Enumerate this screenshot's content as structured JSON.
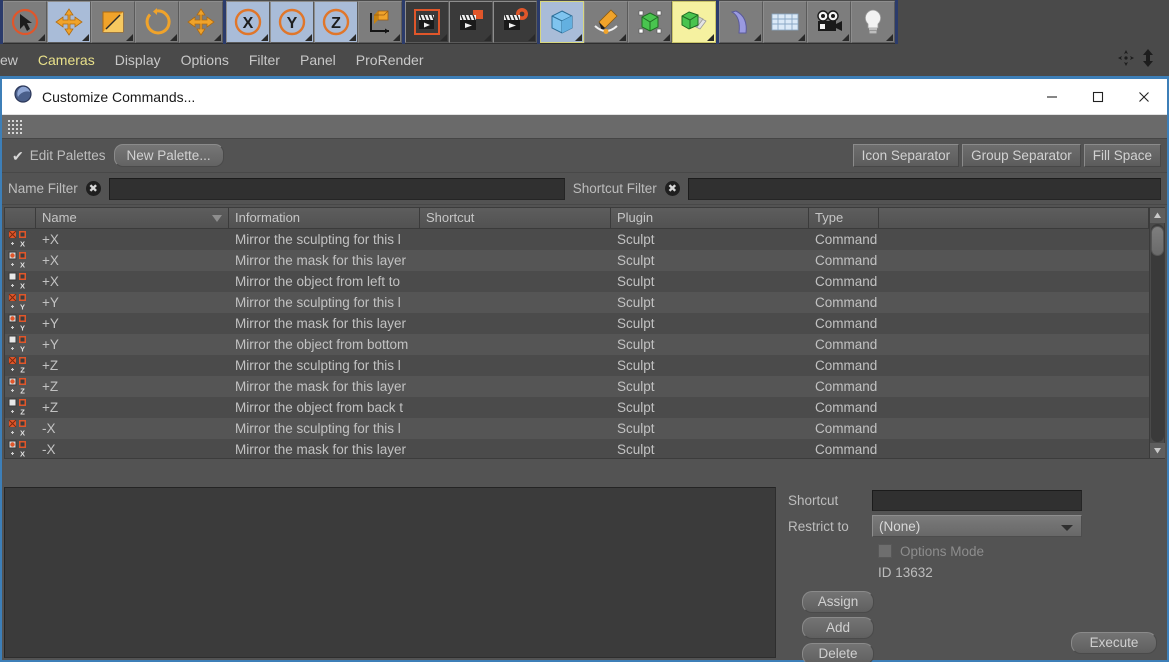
{
  "toolbar": {
    "items": [
      {
        "name": "live-selection-tool",
        "icon": "cursor-circle-icon",
        "state": "selected-red"
      },
      {
        "name": "move-tool",
        "icon": "move-arrows-icon",
        "state": "selected"
      },
      {
        "name": "scale-tool",
        "icon": "scale-square-icon",
        "state": "normal"
      },
      {
        "name": "rotate-tool",
        "icon": "rotate-circle-icon",
        "state": "normal"
      },
      {
        "name": "move-tool-2",
        "icon": "move-arrows-icon",
        "state": "normal"
      },
      {
        "name": "x-axis-lock",
        "icon": "axis-x-icon",
        "state": "selected"
      },
      {
        "name": "y-axis-lock",
        "icon": "axis-y-icon",
        "state": "selected"
      },
      {
        "name": "z-axis-lock",
        "icon": "axis-z-icon",
        "state": "selected"
      },
      {
        "name": "world-object-coordinates",
        "icon": "cube-axis-icon",
        "state": "normal"
      },
      {
        "name": "render-view",
        "icon": "clapper-render-icon",
        "state": "dark-red"
      },
      {
        "name": "render-region",
        "icon": "clapper-region-icon",
        "state": "dark"
      },
      {
        "name": "render-settings",
        "icon": "clapper-gear-icon",
        "state": "dark"
      },
      {
        "name": "add-cube-object",
        "icon": "cube-blue-icon",
        "state": "yellow-outline"
      },
      {
        "name": "add-spline",
        "icon": "pen-spline-icon",
        "state": "normal"
      },
      {
        "name": "generators",
        "icon": "green-cube-array-icon",
        "state": "normal"
      },
      {
        "name": "deformers",
        "icon": "green-cube-stack-icon",
        "state": "yellow-selected"
      },
      {
        "name": "bend-deformer",
        "icon": "bend-shape-icon",
        "state": "normal"
      },
      {
        "name": "floor-environment",
        "icon": "grid-floor-icon",
        "state": "normal"
      },
      {
        "name": "add-camera",
        "icon": "camera-icon",
        "state": "normal"
      },
      {
        "name": "add-light",
        "icon": "light-bulb-icon",
        "state": "normal"
      }
    ]
  },
  "menubar": {
    "items": [
      {
        "label": "ew",
        "active": false
      },
      {
        "label": "Cameras",
        "active": true
      },
      {
        "label": "Display",
        "active": false
      },
      {
        "label": "Options",
        "active": false
      },
      {
        "label": "Filter",
        "active": false
      },
      {
        "label": "Panel",
        "active": false
      },
      {
        "label": "ProRender",
        "active": false
      }
    ],
    "right_icons": [
      "move-cross-icon",
      "resize-vertical-icon"
    ]
  },
  "dialog": {
    "title": "Customize Commands...",
    "app_icon": "cinema4d-logo-icon",
    "window_controls": {
      "minimize": "—",
      "maximize": "□",
      "close": "✕"
    },
    "palettes_bar": {
      "edit_palettes_checked": true,
      "edit_palettes_label": "Edit Palettes",
      "new_palette_label": "New Palette...",
      "icon_separator_label": "Icon Separator",
      "group_separator_label": "Group Separator",
      "fill_space_label": "Fill Space"
    },
    "filters": {
      "name_filter_label": "Name Filter",
      "name_filter_value": "",
      "name_filter_placeholder": "",
      "shortcut_filter_label": "Shortcut Filter",
      "shortcut_filter_value": "",
      "shortcut_filter_placeholder": ""
    },
    "table": {
      "columns": [
        "",
        "Name",
        "Information",
        "Shortcut",
        "Plugin",
        "Type",
        ""
      ],
      "sorted_column": "Name",
      "sort_direction": "descending",
      "rows": [
        {
          "icon": "mirror-sculpt-x-icon",
          "axis": "X",
          "kind": "sculpt",
          "name": "+X",
          "information": "Mirror the sculpting for this l",
          "shortcut": "",
          "plugin": "Sculpt",
          "type": "Command"
        },
        {
          "icon": "mirror-mask-x-icon",
          "axis": "X",
          "kind": "mask",
          "name": "+X",
          "information": "Mirror the mask for this layer",
          "shortcut": "",
          "plugin": "Sculpt",
          "type": "Command"
        },
        {
          "icon": "mirror-object-x-icon",
          "axis": "X",
          "kind": "object",
          "name": "+X",
          "information": "Mirror the object from left to",
          "shortcut": "",
          "plugin": "Sculpt",
          "type": "Command"
        },
        {
          "icon": "mirror-sculpt-y-icon",
          "axis": "Y",
          "kind": "sculpt",
          "name": "+Y",
          "information": "Mirror the sculpting for this l",
          "shortcut": "",
          "plugin": "Sculpt",
          "type": "Command"
        },
        {
          "icon": "mirror-mask-y-icon",
          "axis": "Y",
          "kind": "mask",
          "name": "+Y",
          "information": "Mirror the mask for this layer",
          "shortcut": "",
          "plugin": "Sculpt",
          "type": "Command"
        },
        {
          "icon": "mirror-object-y-icon",
          "axis": "Y",
          "kind": "object",
          "name": "+Y",
          "information": "Mirror the object from bottom",
          "shortcut": "",
          "plugin": "Sculpt",
          "type": "Command"
        },
        {
          "icon": "mirror-sculpt-z-icon",
          "axis": "Z",
          "kind": "sculpt",
          "name": "+Z",
          "information": "Mirror the sculpting for this l",
          "shortcut": "",
          "plugin": "Sculpt",
          "type": "Command"
        },
        {
          "icon": "mirror-mask-z-icon",
          "axis": "Z",
          "kind": "mask",
          "name": "+Z",
          "information": "Mirror the mask for this layer",
          "shortcut": "",
          "plugin": "Sculpt",
          "type": "Command"
        },
        {
          "icon": "mirror-object-z-icon",
          "axis": "Z",
          "kind": "object",
          "name": "+Z",
          "information": "Mirror the object from back t",
          "shortcut": "",
          "plugin": "Sculpt",
          "type": "Command"
        },
        {
          "icon": "mirror-sculpt-negx-icon",
          "axis": "X",
          "kind": "sculpt",
          "name": "-X",
          "information": "Mirror the sculpting for this l",
          "shortcut": "",
          "plugin": "Sculpt",
          "type": "Command"
        },
        {
          "icon": "mirror-mask-negx-icon",
          "axis": "X",
          "kind": "mask",
          "name": "-X",
          "information": "Mirror the mask for this layer",
          "shortcut": "",
          "plugin": "Sculpt",
          "type": "Command"
        }
      ]
    },
    "properties": {
      "shortcut_label": "Shortcut",
      "shortcut_value": "",
      "restrict_to_label": "Restrict to",
      "restrict_to_value": "(None)",
      "restrict_to_options": [
        "(None)"
      ],
      "options_mode_label": "Options Mode",
      "options_mode_checked": false,
      "id_label": "ID 13632",
      "assign_label": "Assign",
      "add_label": "Add",
      "delete_label": "Delete",
      "execute_label": "Execute"
    },
    "description_pane_text": ""
  },
  "colors": {
    "window_bg": "#535353",
    "panel_bg": "#4a4a4a",
    "accent_blue": "#3d7fb8",
    "menu_active": "#e8e08a",
    "text": "#c2c2c2",
    "field_bg": "#303030",
    "icon_orange": "#e0562a",
    "row_odd": "#4b4b4b",
    "row_even": "#555555"
  }
}
